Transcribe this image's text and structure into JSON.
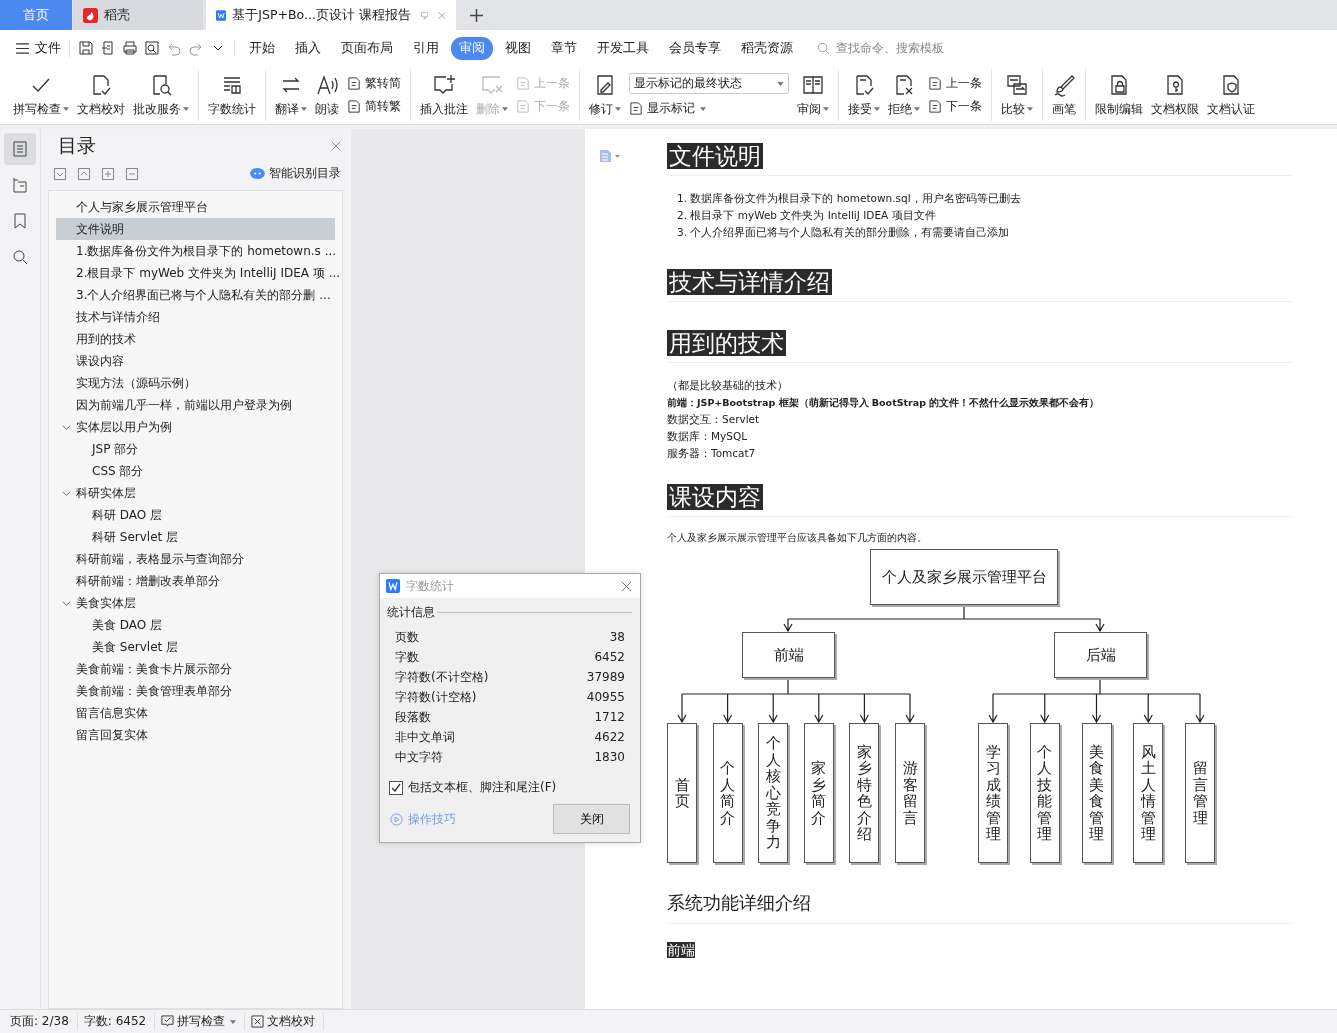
{
  "tabs": [
    {
      "label": "首页",
      "kind": "home",
      "selected": false
    },
    {
      "label": "稻壳",
      "kind": "docer",
      "selected": false
    },
    {
      "label": "基于JSP+Bo...页设计 课程报告",
      "kind": "document",
      "selected": true
    }
  ],
  "menu": {
    "file": "文件",
    "items": [
      {
        "label": "开始",
        "selected": false
      },
      {
        "label": "插入",
        "selected": false
      },
      {
        "label": "页面布局",
        "selected": false
      },
      {
        "label": "引用",
        "selected": false
      },
      {
        "label": "审阅",
        "selected": true
      },
      {
        "label": "视图",
        "selected": false
      },
      {
        "label": "章节",
        "selected": false
      },
      {
        "label": "开发工具",
        "selected": false
      },
      {
        "label": "会员专享",
        "selected": false
      },
      {
        "label": "稻壳资源",
        "selected": false
      }
    ],
    "search_placeholder": "查找命令、搜索模板"
  },
  "ribbon": {
    "groups": [
      {
        "tools": [
          {
            "kind": "large",
            "label": "拼写检查",
            "dropdown": true,
            "disabled": false
          },
          {
            "kind": "large",
            "label": "文档校对",
            "dropdown": false,
            "disabled": false
          },
          {
            "kind": "large",
            "label": "批改服务",
            "dropdown": true,
            "disabled": false
          }
        ]
      },
      {
        "tools": [
          {
            "kind": "large",
            "label": "字数统计",
            "dropdown": false,
            "disabled": false
          }
        ]
      },
      {
        "tools": [
          {
            "kind": "large",
            "label": "翻译",
            "dropdown": true,
            "disabled": false
          },
          {
            "kind": "large",
            "label": "朗读",
            "dropdown": false,
            "disabled": false
          },
          {
            "kind": "stack",
            "items": [
              {
                "label": "繁转简",
                "dropdown": false,
                "disabled": false
              },
              {
                "label": "简转繁",
                "dropdown": false,
                "disabled": false
              }
            ]
          }
        ]
      },
      {
        "tools": [
          {
            "kind": "large",
            "label": "插入批注",
            "dropdown": false,
            "disabled": false
          },
          {
            "kind": "large",
            "label": "删除",
            "dropdown": true,
            "disabled": true
          },
          {
            "kind": "stack",
            "items": [
              {
                "label": "上一条",
                "dropdown": false,
                "disabled": true
              },
              {
                "label": "下一条",
                "dropdown": false,
                "disabled": true
              }
            ]
          }
        ]
      },
      {
        "tools": [
          {
            "kind": "large",
            "label": "修订",
            "dropdown": true,
            "disabled": false
          },
          {
            "kind": "select",
            "value": "显示标记的最终状态",
            "items": [
              {
                "label": "显示标记",
                "dropdown": true,
                "disabled": false
              }
            ]
          },
          {
            "kind": "large",
            "label": "审阅",
            "dropdown": true,
            "disabled": false
          }
        ]
      },
      {
        "tools": [
          {
            "kind": "large",
            "label": "接受",
            "dropdown": true,
            "disabled": false
          },
          {
            "kind": "large",
            "label": "拒绝",
            "dropdown": true,
            "disabled": false
          },
          {
            "kind": "stack",
            "items": [
              {
                "label": "上一条",
                "dropdown": false,
                "disabled": false
              },
              {
                "label": "下一条",
                "dropdown": false,
                "disabled": false
              }
            ]
          }
        ]
      },
      {
        "tools": [
          {
            "kind": "large",
            "label": "比较",
            "dropdown": true,
            "disabled": false
          }
        ]
      },
      {
        "tools": [
          {
            "kind": "large",
            "label": "画笔",
            "dropdown": false,
            "disabled": false
          }
        ]
      },
      {
        "tools": [
          {
            "kind": "large",
            "label": "限制编辑",
            "dropdown": false,
            "disabled": false
          },
          {
            "kind": "large",
            "label": "文档权限",
            "dropdown": false,
            "disabled": false
          },
          {
            "kind": "large",
            "label": "文档认证",
            "dropdown": false,
            "disabled": false
          }
        ]
      }
    ]
  },
  "rail": [
    {
      "selected": true
    },
    {
      "selected": false
    },
    {
      "selected": false
    },
    {
      "selected": false
    }
  ],
  "toc": {
    "title": "目录",
    "smart_button": "智能识别目录",
    "items": [
      {
        "label": "个人与家乡展示管理平台",
        "selected": false
      },
      {
        "label": "文件说明",
        "selected": true
      },
      {
        "label": "1.数据库备份文件为根目录下的 hometown.s ...",
        "selected": false
      },
      {
        "label": "2.根目录下 myWeb 文件夹为 IntelliJ IDEA 项 ...",
        "selected": false
      },
      {
        "label": "3.个人介绍界面已将与个人隐私有关的部分删 ...",
        "selected": false
      },
      {
        "label": "技术与详情介绍",
        "selected": false
      },
      {
        "label": "用到的技术",
        "selected": false
      },
      {
        "label": "课设内容",
        "selected": false
      },
      {
        "label": "实现方法（源码示例）",
        "selected": false
      },
      {
        "label": "因为前端几乎一样，前端以用户登录为例",
        "selected": false
      },
      {
        "label": "实体层以用户为例",
        "selected": false,
        "expanded": true,
        "children": [
          {
            "label": "JSP 部分",
            "selected": false
          },
          {
            "label": "CSS 部分",
            "selected": false
          }
        ]
      },
      {
        "label": "科研实体层",
        "selected": false,
        "expanded": true,
        "children": [
          {
            "label": "科研 DAO 层",
            "selected": false
          },
          {
            "label": "科研 Servlet 层",
            "selected": false
          }
        ]
      },
      {
        "label": "科研前端，表格显示与查询部分",
        "selected": false
      },
      {
        "label": "科研前端：增删改表单部分",
        "selected": false
      },
      {
        "label": "美食实体层",
        "selected": false,
        "expanded": true,
        "children": [
          {
            "label": "美食 DAO 层",
            "selected": false
          },
          {
            "label": "美食 Servlet 层",
            "selected": false
          }
        ]
      },
      {
        "label": "美食前端：美食卡片展示部分",
        "selected": false
      },
      {
        "label": "美食前端：美食管理表单部分",
        "selected": false
      },
      {
        "label": "留言信息实体",
        "selected": false
      },
      {
        "label": "留言回复实体",
        "selected": false
      }
    ]
  },
  "document": {
    "blocks": [
      {
        "kind": "heading",
        "text": "文件说明"
      },
      {
        "kind": "list",
        "items": [
          "1. 数据库备份文件为根目录下的 hometown.sql，用户名密码等已删去",
          "2. 根目录下 myWeb 文件夹为 IntelliJ IDEA 项目文件",
          "3. 个人介绍界面已将与个人隐私有关的部分删除，有需要请自己添加"
        ]
      },
      {
        "kind": "heading",
        "text": "技术与详情介绍"
      },
      {
        "kind": "heading",
        "text": "用到的技术"
      },
      {
        "kind": "lines",
        "items": [
          {
            "text": "（都是比较基础的技术）",
            "bold": false
          },
          {
            "text": "前端：JSP+Bootstrap 框架（萌新记得导入 BootStrap 的文件！不然什么显示效果都不会有）",
            "bold": true
          },
          {
            "text": "数据交互：Servlet",
            "bold": false
          },
          {
            "text": "数据库：MySQL",
            "bold": false
          },
          {
            "text": "服务器：Tomcat7",
            "bold": false
          }
        ]
      },
      {
        "kind": "heading",
        "text": "课设内容"
      },
      {
        "kind": "paragraph",
        "text": "个人及家乡展示展示管理平台应该具备如下几方面的内容。"
      },
      {
        "kind": "tree",
        "root": {
          "label": "个人及家乡展示管理平台",
          "children": [
            {
              "label": "前端",
              "children": [
                {
                  "label": "首页"
                },
                {
                  "label": "个人简介"
                },
                {
                  "label": "个人核心竞争力"
                },
                {
                  "label": "家乡简介"
                },
                {
                  "label": "家乡特色介绍"
                },
                {
                  "label": "游客留言"
                }
              ]
            },
            {
              "label": "后端",
              "children": [
                {
                  "label": "学习成绩管理"
                },
                {
                  "label": "个人技能管理"
                },
                {
                  "label": "美食美食管理"
                },
                {
                  "label": "风土人情管理"
                },
                {
                  "label": "留言管理"
                }
              ]
            }
          ]
        }
      },
      {
        "kind": "subheading",
        "text": "系统功能详细介绍"
      },
      {
        "kind": "highlight",
        "text": "前端"
      }
    ]
  },
  "dialog": {
    "title": "字数统计",
    "group": "统计信息",
    "rows": [
      {
        "label": "页数",
        "value": "38"
      },
      {
        "label": "字数",
        "value": "6452"
      },
      {
        "label": "字符数(不计空格)",
        "value": "37989"
      },
      {
        "label": "字符数(计空格)",
        "value": "40955"
      },
      {
        "label": "段落数",
        "value": "1712"
      },
      {
        "label": "非中文单词",
        "value": "4622"
      },
      {
        "label": "中文字符",
        "value": "1830"
      }
    ],
    "checkbox": {
      "label": "包括文本框、脚注和尾注(F)",
      "checked": true
    },
    "tips_link": "操作技巧",
    "close_button": "关闭"
  },
  "status_bar": {
    "page": "页面: 2/38",
    "words": "字数: 6452",
    "spell_check": "拼写检查",
    "proofread": "文档校对"
  }
}
